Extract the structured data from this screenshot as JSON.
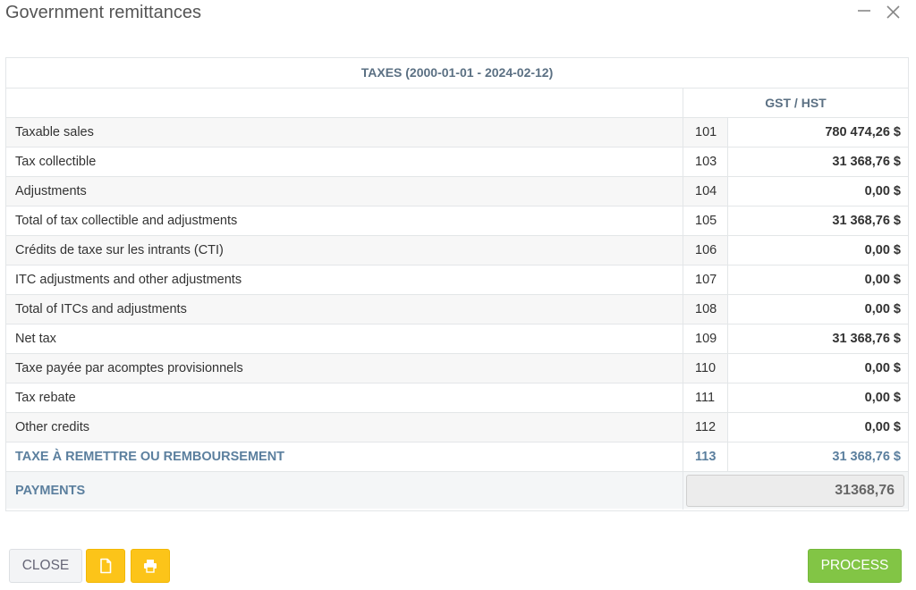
{
  "window": {
    "title": "Government remittances"
  },
  "table": {
    "header": "TAXES (2000-01-01 - 2024-02-12)",
    "column_header": "GST / HST",
    "rows": [
      {
        "label": "Taxable sales",
        "code": "101",
        "value": "780 474,26 $"
      },
      {
        "label": "Tax collectible",
        "code": "103",
        "value": "31 368,76 $"
      },
      {
        "label": "Adjustments",
        "code": "104",
        "value": "0,00 $"
      },
      {
        "label": "Total of tax collectible and adjustments",
        "code": "105",
        "value": "31 368,76 $"
      },
      {
        "label": "Crédits de taxe sur les intrants (CTI)",
        "code": "106",
        "value": "0,00 $"
      },
      {
        "label": "ITC adjustments and other adjustments",
        "code": "107",
        "value": "0,00 $"
      },
      {
        "label": "Total of ITCs and adjustments",
        "code": "108",
        "value": "0,00 $"
      },
      {
        "label": "Net tax",
        "code": "109",
        "value": "31 368,76 $"
      },
      {
        "label": "Taxe payée par acomptes provisionnels",
        "code": "110",
        "value": "0,00 $"
      },
      {
        "label": "Tax rebate",
        "code": "111",
        "value": "0,00 $"
      },
      {
        "label": "Other credits",
        "code": "112",
        "value": "0,00 $"
      },
      {
        "label": "TAXE À REMETTRE OU REMBOURSEMENT",
        "code": "113",
        "value": "31 368,76 $"
      }
    ],
    "payments_label": "PAYMENTS",
    "payments_value": "31368,76"
  },
  "footer": {
    "close_label": "CLOSE",
    "process_label": "PROCESS"
  },
  "colors": {
    "accent_text": "#5b7f9e",
    "yellow_button": "#fcc419",
    "green_button": "#82c545"
  },
  "icons": {
    "minimize": "minimize-icon",
    "close": "close-icon",
    "file": "file-icon",
    "print": "print-icon"
  }
}
